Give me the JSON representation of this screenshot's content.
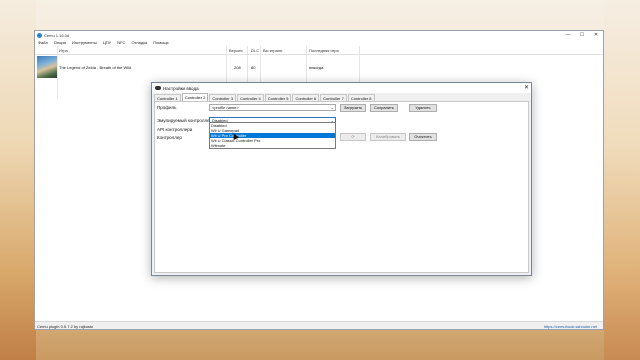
{
  "window": {
    "title": "Cemu 1.16.0d",
    "controls": {
      "minimize": "—",
      "maximize": "☐",
      "close": "✕"
    }
  },
  "menu": [
    "Файл",
    "Опции",
    "Инструменты",
    "ЦПУ",
    "NFC",
    "Отладка",
    "Помощь"
  ],
  "game_list": {
    "headers": {
      "game": "Игра",
      "version": "Версия",
      "dlc": "DLC",
      "played": "Вы играли",
      "last_played": "Последняя игра"
    },
    "rows": [
      {
        "title": "The Legend of Zelda - Breath of the Wild",
        "version": "208",
        "dlc": "80",
        "played": "",
        "last_played": "никогда"
      }
    ]
  },
  "status": {
    "left": "Cemu plugin 0.5.7.2 by rajkosto",
    "right": "https://cemuhook.sshnuke.net"
  },
  "dialog": {
    "title": "Настройки ввода",
    "close": "✕",
    "tabs": [
      "Controller 1",
      "Controller 2",
      "Controller 3",
      "Controller 4",
      "Controller 5",
      "Controller 6",
      "Controller 7",
      "Controller 8"
    ],
    "active_tab": "Controller 2",
    "profile": {
      "label": "Профиль",
      "value": "<profile name>",
      "load": "Загрузить",
      "save": "Сохранить",
      "delete": "Удалить"
    },
    "emulated": {
      "label": "Эмулируемый контроллер",
      "value": "Disabled",
      "options": [
        "Disabled",
        "Wii U Gamepad",
        "Wii U Pro Controller",
        "Wii U Classic Controller Pro",
        "Wiimote"
      ],
      "highlighted": "Wii U Pro Controller"
    },
    "api_label": "API контроллера",
    "controller_label": "Контроллер",
    "refresh": "⟳",
    "calibrate": "Калибровать",
    "clear": "Очистить"
  }
}
